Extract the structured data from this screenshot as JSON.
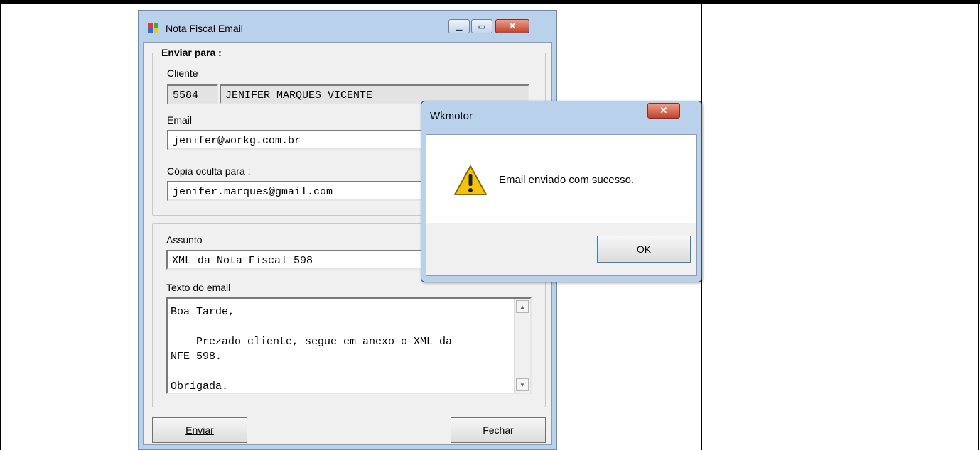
{
  "main_window": {
    "title": "Nota Fiscal Email",
    "icon": "windows-app-icon",
    "controls": [
      "minimize",
      "maximize",
      "close"
    ]
  },
  "enviar_para": {
    "legend": "Enviar para :",
    "cliente_label": "Cliente",
    "cliente_code": "5584",
    "cliente_name": "JENIFER MARQUES VICENTE",
    "email_label": "Email",
    "email_value": "jenifer@workg.com.br",
    "bcc_label": "Cópia oculta para :",
    "bcc_value": "jenifer.marques@gmail.com"
  },
  "mensagem": {
    "assunto_label": "Assunto",
    "assunto_value": "XML da Nota Fiscal 598",
    "texto_label": "Texto do email",
    "texto_value": "Boa Tarde,\n\n    Prezado cliente, segue em anexo o XML da\nNFE 598.\n\nObrigada."
  },
  "buttons": {
    "enviar": "Enviar",
    "fechar": "Fechar"
  },
  "dialog": {
    "title": "Wkmotor",
    "message": "Email enviado com sucesso.",
    "ok_label": "OK",
    "icon": "warning-icon"
  },
  "colors": {
    "window_frame": "#b9d1ea",
    "client_bg": "#f0f0f0",
    "close_button": "#c4402a",
    "warning": "#f2c411"
  }
}
